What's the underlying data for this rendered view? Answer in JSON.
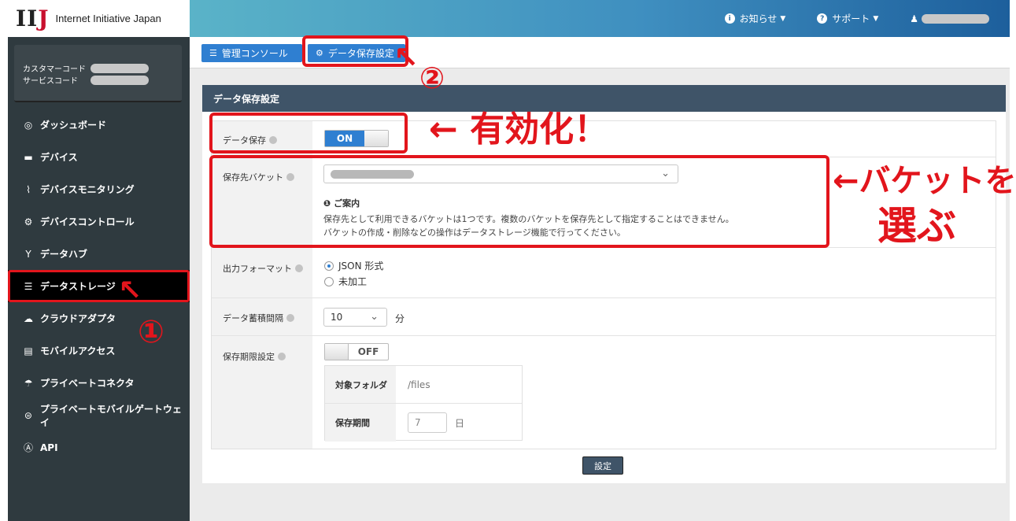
{
  "logo": {
    "mark": "IIJ",
    "text": "Internet Initiative Japan"
  },
  "account": {
    "customer_code_label": "カスタマーコード",
    "service_code_label": "サービスコード"
  },
  "sidebar": {
    "items": [
      {
        "label": "ダッシュボード",
        "icon": "dashboard-icon",
        "glyph": "◎"
      },
      {
        "label": "デバイス",
        "icon": "router-icon",
        "glyph": "▬"
      },
      {
        "label": "デバイスモニタリング",
        "icon": "pulse-icon",
        "glyph": "⌇"
      },
      {
        "label": "デバイスコントロール",
        "icon": "gear-icon",
        "glyph": "⚙"
      },
      {
        "label": "データハブ",
        "icon": "fork-icon",
        "glyph": "Y"
      },
      {
        "label": "データストレージ",
        "icon": "database-icon",
        "glyph": "☰"
      },
      {
        "label": "クラウドアダプタ",
        "icon": "cloud-icon",
        "glyph": "☁"
      },
      {
        "label": "モバイルアクセス",
        "icon": "sim-icon",
        "glyph": "▤"
      },
      {
        "label": "プライベートコネクタ",
        "icon": "cloud-lock-icon",
        "glyph": "☂"
      },
      {
        "label": "プライベートモバイルゲートウェイ",
        "icon": "gateway-icon",
        "glyph": "⊜"
      },
      {
        "label": "API",
        "icon": "api-icon",
        "glyph": "Ⓐ"
      }
    ]
  },
  "header": {
    "notice": {
      "label": "お知らせ",
      "icon": "info-icon",
      "glyph": "i"
    },
    "support": {
      "label": "サポート",
      "icon": "question-icon",
      "glyph": "?"
    },
    "user": {
      "icon": "user-icon",
      "glyph": "👤"
    }
  },
  "tabs": [
    {
      "label": "管理コンソール",
      "icon": "database-icon",
      "glyph": "☰"
    },
    {
      "label": "データ保存設定",
      "icon": "gear-icon",
      "glyph": "⚙"
    }
  ],
  "panel": {
    "title": "データ保存設定",
    "data_save": {
      "label": "データ保存",
      "toggle": "ON"
    },
    "bucket": {
      "label": "保存先バケット",
      "info_title": "ご案内",
      "info_lines": [
        "保存先として利用できるバケットは1つです。複数のバケットを保存先として指定することはできません。",
        "バケットの作成・削除などの操作はデータストレージ機能で行ってください。"
      ]
    },
    "format": {
      "label": "出力フォーマット",
      "options": [
        "JSON 形式",
        "未加工"
      ],
      "selected": "JSON 形式"
    },
    "interval": {
      "label": "データ蓄積間隔",
      "value": "10",
      "unit": "分"
    },
    "retention": {
      "label": "保存期限設定",
      "toggle": "OFF",
      "folder_label": "対象フォルダ",
      "folder_value": "/files",
      "period_label": "保存期間",
      "period_value": "7",
      "period_unit": "日"
    },
    "submit_label": "設定"
  },
  "annotations": {
    "step1": "①",
    "step2": "②",
    "enable": "← 有効化！",
    "choose_bucket_line1": "←バケットを",
    "choose_bucket_line2": "選ぶ",
    "color": "#e2151c"
  }
}
